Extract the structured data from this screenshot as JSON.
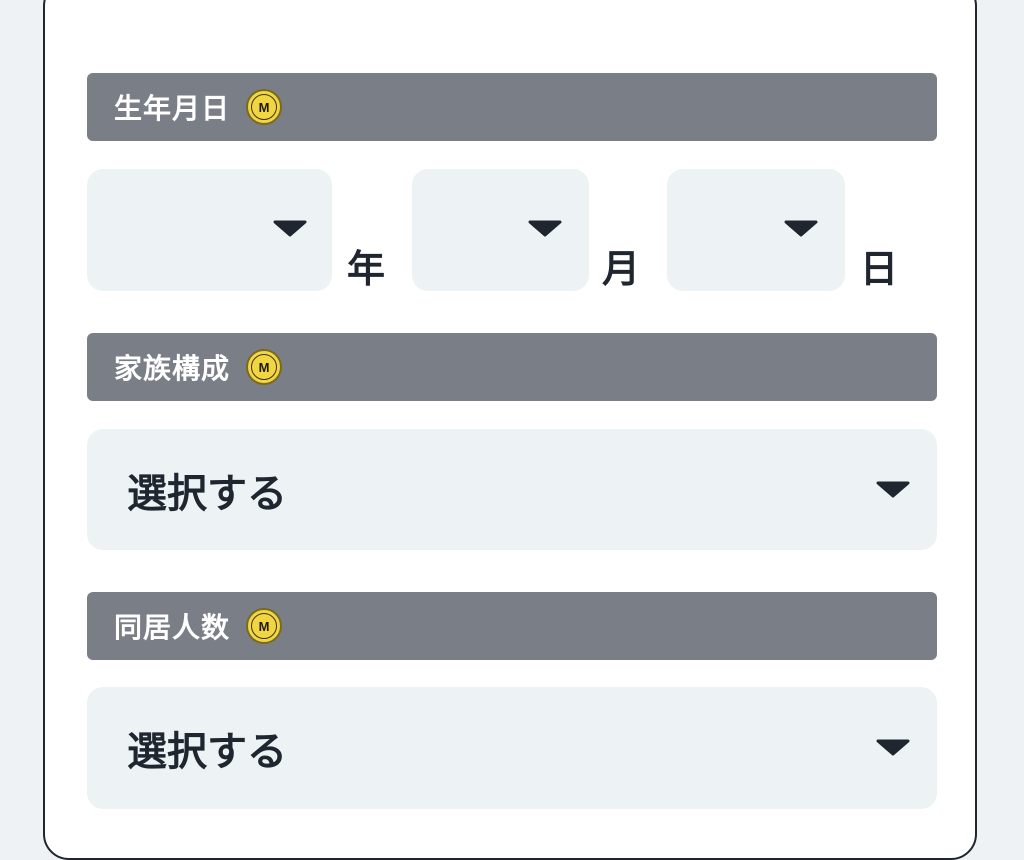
{
  "birthdate": {
    "header": "生年月日",
    "badge": "M",
    "year_unit": "年",
    "month_unit": "月",
    "day_unit": "日",
    "year_value": "",
    "month_value": "",
    "day_value": ""
  },
  "family": {
    "header": "家族構成",
    "badge": "M",
    "select_value": "選択する"
  },
  "household": {
    "header": "同居人数",
    "badge": "M",
    "select_value": "選択する"
  },
  "colors": {
    "header_bg": "#7a7f87",
    "select_bg": "#edf2f4",
    "text": "#1f2630",
    "badge": "#f2d542"
  }
}
